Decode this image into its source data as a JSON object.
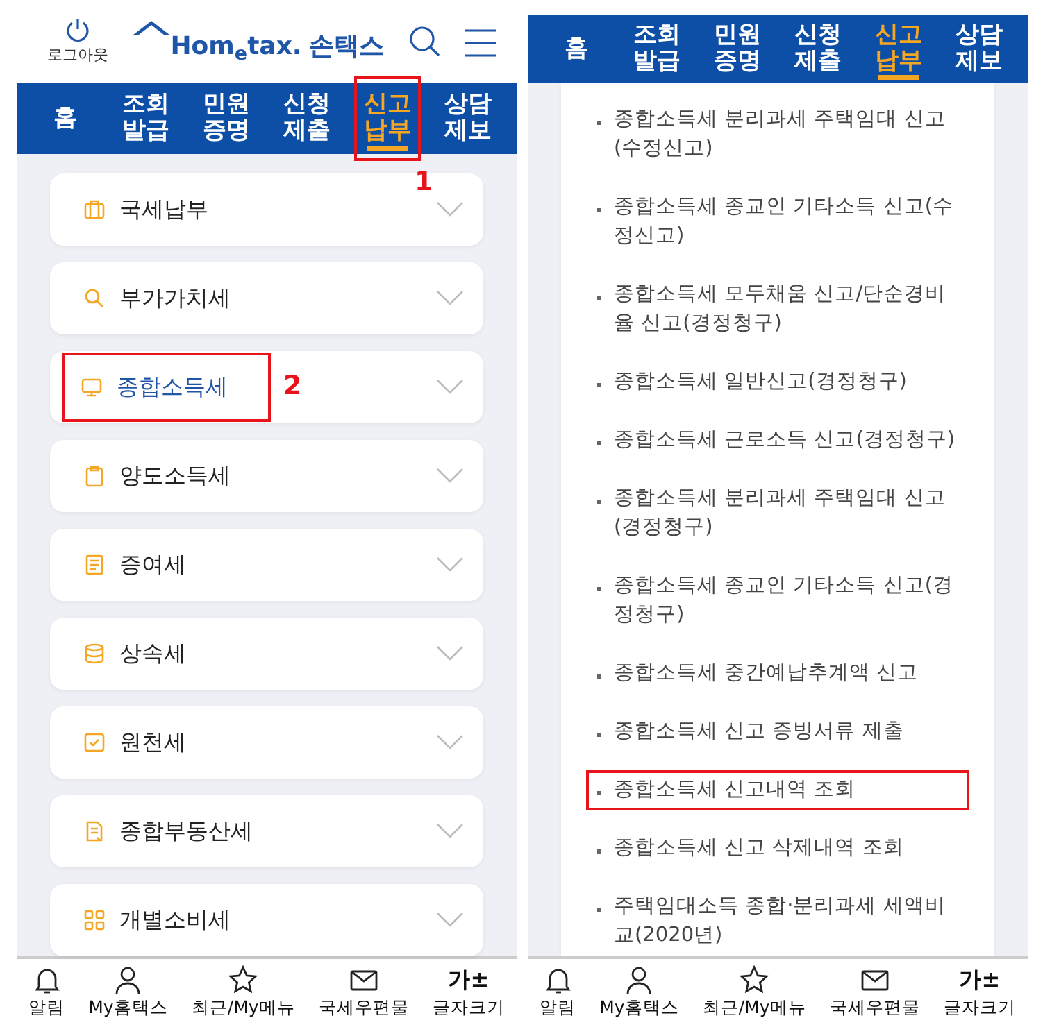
{
  "left_screen": {
    "header": {
      "logout_label": "로그아웃",
      "logo_text": "Hom$_{e}$tax.",
      "logo_subtitle": "손택스"
    },
    "tabs": [
      {
        "label": "홈",
        "selected": false
      },
      {
        "label": "조회발급",
        "selected": false
      },
      {
        "label": "민원증명",
        "selected": false
      },
      {
        "label": "신청제출",
        "selected": false
      },
      {
        "label": "신고납부",
        "selected": true,
        "annotation": "1"
      },
      {
        "label": "상담제보",
        "selected": false
      }
    ],
    "categories": [
      {
        "label": "국세납부",
        "selected": false
      },
      {
        "label": "부가가치세",
        "selected": false
      },
      {
        "label": "종합소득세",
        "selected": true,
        "annotation": "2"
      },
      {
        "label": "양도소득세",
        "selected": false
      },
      {
        "label": "증여세",
        "selected": false
      },
      {
        "label": "상속세",
        "selected": false
      },
      {
        "label": "원천세",
        "selected": false
      },
      {
        "label": "종합부동산세",
        "selected": false
      },
      {
        "label": "개별소비세",
        "selected": false
      }
    ],
    "bottom_nav": [
      {
        "label": "알림"
      },
      {
        "label": "My홈택스"
      },
      {
        "label": "최근/My메뉴"
      },
      {
        "label": "국세우편물"
      },
      {
        "label": "글자크기",
        "glyph": "가±"
      }
    ]
  },
  "right_screen": {
    "tabs": [
      {
        "label": "홈",
        "selected": false
      },
      {
        "label": "조회발급",
        "selected": false
      },
      {
        "label": "민원증명",
        "selected": false
      },
      {
        "label": "신청제출",
        "selected": false
      },
      {
        "label": "신고납부",
        "selected": true
      },
      {
        "label": "상담제보",
        "selected": false
      }
    ],
    "menu_items": [
      {
        "label": "종합소득세 분리과세 주택임대 신고(수정신고)",
        "boxed": false
      },
      {
        "label": "종합소득세 종교인 기타소득 신고(수정신고)",
        "boxed": false
      },
      {
        "label": "종합소득세 모두채움 신고/단순경비율 신고(경정청구)",
        "boxed": false
      },
      {
        "label": "종합소득세 일반신고(경정청구)",
        "boxed": false
      },
      {
        "label": "종합소득세 근로소득 신고(경정청구)",
        "boxed": false
      },
      {
        "label": "종합소득세 분리과세 주택임대 신고(경정청구)",
        "boxed": false
      },
      {
        "label": "종합소득세 종교인 기타소득 신고(경정청구)",
        "boxed": false
      },
      {
        "label": "종합소득세 중간예납추계액 신고",
        "boxed": false
      },
      {
        "label": "종합소득세 신고 증빙서류 제출",
        "boxed": false
      },
      {
        "label": "종합소득세 신고내역 조회",
        "boxed": true
      },
      {
        "label": "종합소득세 신고 삭제내역 조회",
        "boxed": false
      },
      {
        "label": "주택임대소득 종합·분리과세 세액비교(2020년)",
        "boxed": false
      }
    ],
    "bottom_nav": [
      {
        "label": "알림"
      },
      {
        "label": "My홈택스"
      },
      {
        "label": "최근/My메뉴"
      },
      {
        "label": "국세우편물"
      },
      {
        "label": "글자크기",
        "glyph": "가±"
      }
    ]
  }
}
